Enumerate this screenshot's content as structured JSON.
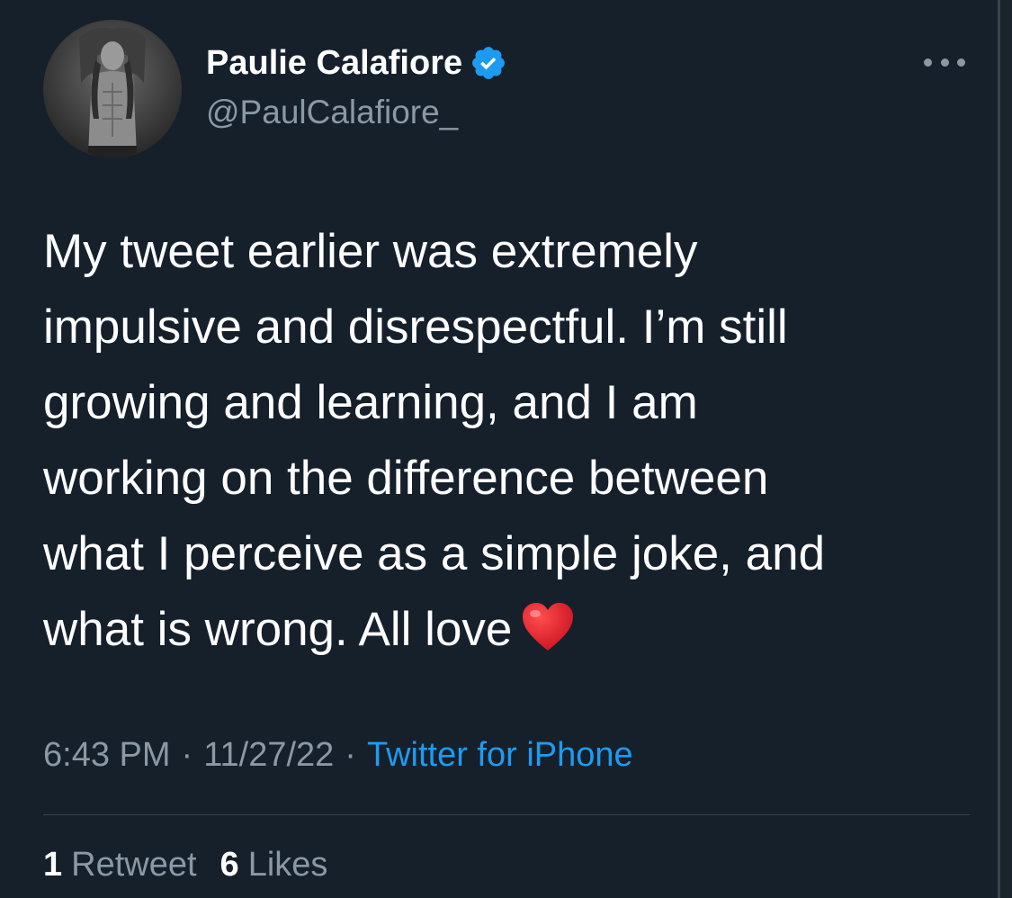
{
  "tweet": {
    "author": {
      "display_name": "Paulie Calafiore",
      "handle": "@PaulCalafiore_",
      "verified": true,
      "verified_color": "#1d9bf0"
    },
    "text": "My tweet earlier was extremely\nimpulsive and disrespectful. I’m still\ngrowing and learning, and I am\nworking on the difference between\nwhat I perceive as a simple joke, and\nwhat is wrong. All love",
    "emoji": "red-heart-icon",
    "time": "6:43 PM",
    "date": "11/27/22",
    "separator": "·",
    "source": "Twitter for iPhone",
    "stats": {
      "retweets_count": "1",
      "retweets_label": "Retweet",
      "likes_count": "6",
      "likes_label": "Likes"
    }
  },
  "colors": {
    "background": "#15202b",
    "text_primary": "#ffffff",
    "text_secondary": "#8b98a5",
    "accent": "#1d9bf0",
    "divider": "#38444d"
  }
}
